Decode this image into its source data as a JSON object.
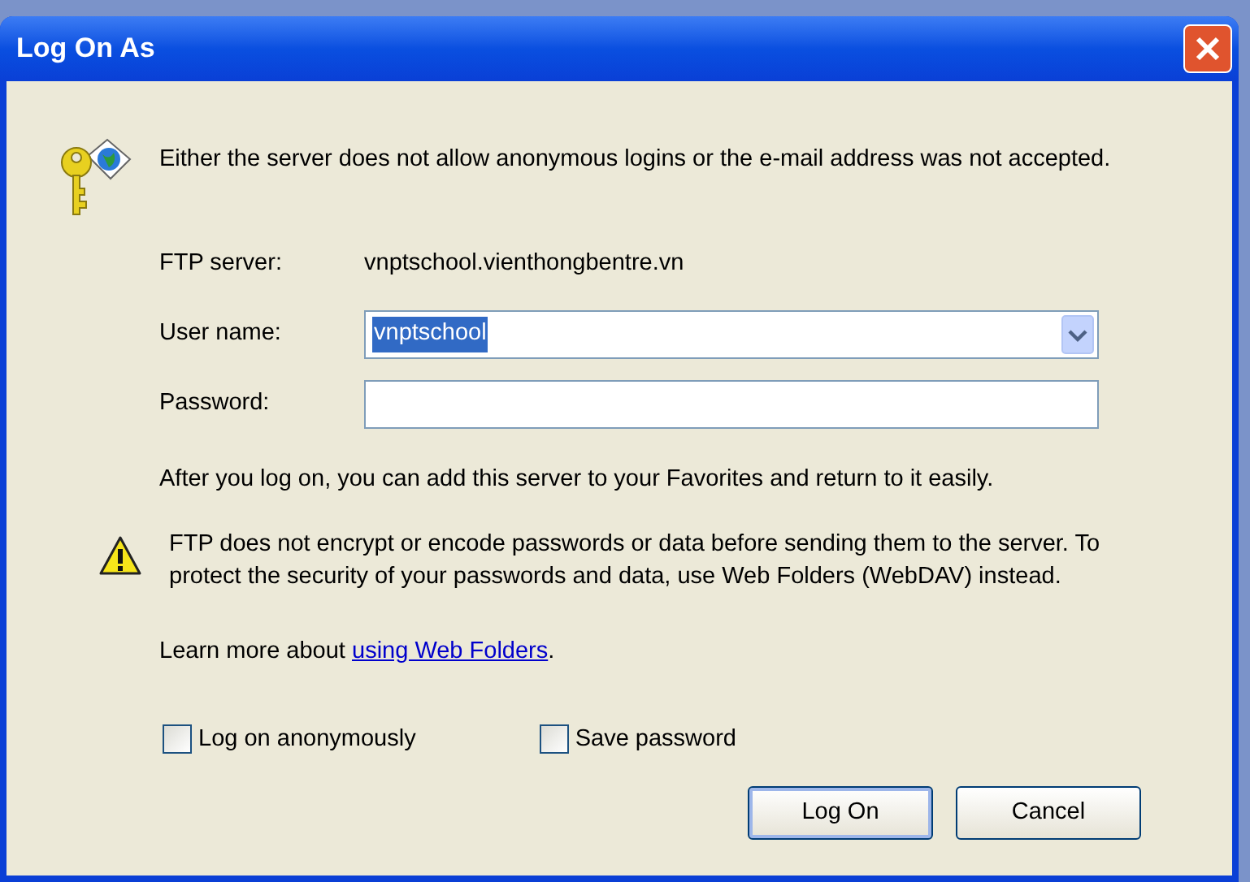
{
  "window": {
    "title": "Log On As"
  },
  "message": "Either the server does not allow anonymous logins or the e-mail address was not accepted.",
  "fields": [
    {
      "kind": "static",
      "label": "FTP server:",
      "value": "vnptschool.vienthongbentre.vn"
    },
    {
      "kind": "combo",
      "label": "User name:",
      "value": "vnptschool",
      "selected": true
    },
    {
      "kind": "password",
      "label": "Password:"
    }
  ],
  "favorites_note": "After you log on, you can add this server to your Favorites and return to it easily.",
  "warning": "FTP does not encrypt or encode passwords or data before sending them to the server.  To protect the security of your passwords and data, use Web Folders (WebDAV) instead.",
  "learn_more": {
    "before": "Learn more about ",
    "link": "using Web Folders",
    "after": "."
  },
  "checkboxes": [
    {
      "label": "Log on anonymously",
      "checked": false
    },
    {
      "label": "Save password",
      "checked": false
    }
  ],
  "buttons": [
    {
      "label": "Log On",
      "default": true
    },
    {
      "label": "Cancel",
      "default": false
    }
  ]
}
